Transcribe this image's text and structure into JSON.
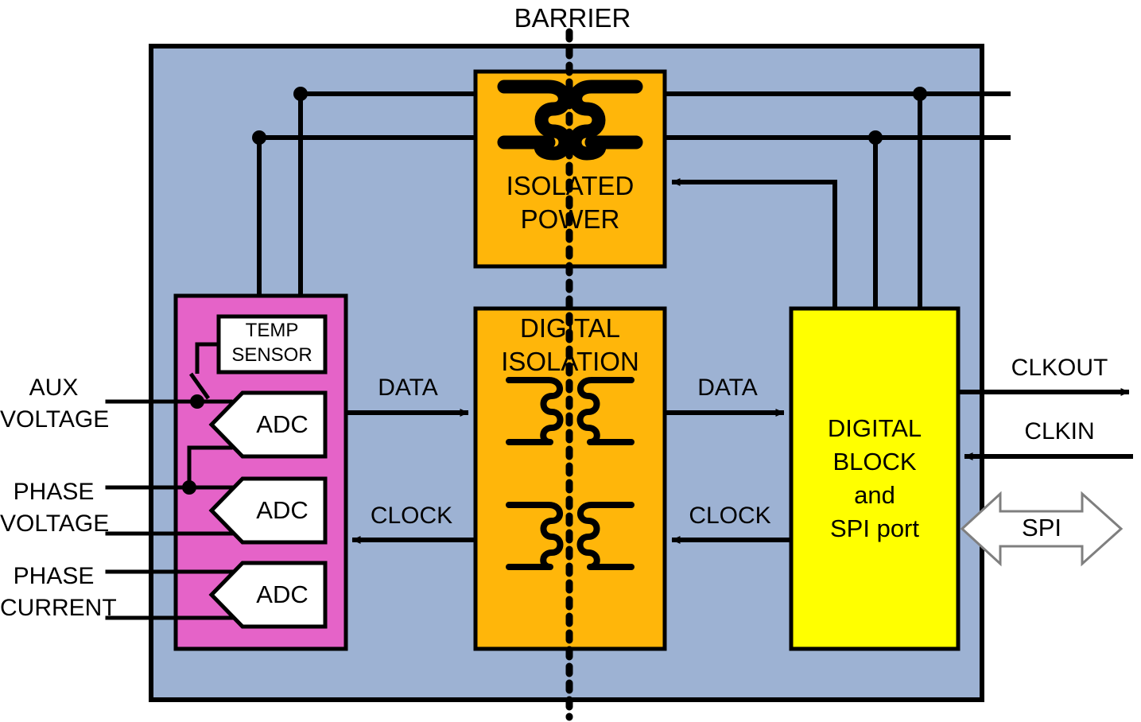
{
  "diagram": {
    "title_label": "BARRIER",
    "colors": {
      "panel": "#9db2d3",
      "isolated_power": "#FFB60A",
      "digital_isolation": "#FFB60A",
      "analog_front_end": "#E563C8",
      "digital_block": "#FFFF00",
      "stroke": "#000000",
      "white": "#FFFFFF",
      "spi_arrow_outline": "#7F7F7F"
    },
    "blocks": {
      "isolated_power": {
        "line1": "ISOLATED",
        "line2": "POWER",
        "icon": "transformer-coil-icon"
      },
      "digital_isolation": {
        "line1": "DIGITAL",
        "line2": "ISOLATION",
        "icon_top": "transformer-coil-icon",
        "icon_bottom": "transformer-coil-icon"
      },
      "digital_block": {
        "line1": "DIGITAL",
        "line2": "BLOCK",
        "line3": "and",
        "line4": "SPI port"
      },
      "temp_sensor": {
        "line1": "TEMP",
        "line2": "SENSOR"
      },
      "adc1": {
        "label": "ADC"
      },
      "adc2": {
        "label": "ADC"
      },
      "adc3": {
        "label": "ADC"
      }
    },
    "inputs": [
      {
        "name": "aux-voltage",
        "line1": "AUX",
        "line2": "VOLTAGE"
      },
      {
        "name": "phase-voltage",
        "line1": "PHASE",
        "line2": "VOLTAGE"
      },
      {
        "name": "phase-current",
        "line1": "PHASE",
        "line2": "CURRENT"
      }
    ],
    "signals": {
      "data_left": "DATA",
      "data_right": "DATA",
      "clock_left": "CLOCK",
      "clock_right": "CLOCK"
    },
    "outputs": {
      "clkout": "CLKOUT",
      "clkin": "CLKIN",
      "spi": "SPI"
    }
  }
}
